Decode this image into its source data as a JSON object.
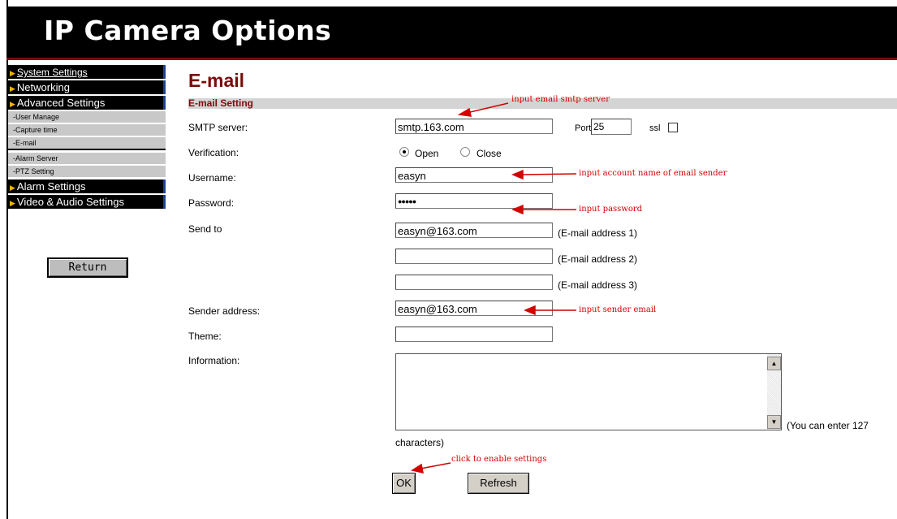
{
  "header": {
    "title": "IP Camera Options"
  },
  "sidebar": {
    "items": [
      {
        "label": "System Settings"
      },
      {
        "label": "Networking"
      },
      {
        "label": "Advanced Settings"
      }
    ],
    "subitems": [
      {
        "label": "-User Manage"
      },
      {
        "label": "-Capture time"
      },
      {
        "label": "-E-mail"
      },
      {
        "label": "-Alarm Server"
      },
      {
        "label": "-PTZ Setting"
      }
    ],
    "items2": [
      {
        "label": "Alarm Settings"
      },
      {
        "label": "Video & Audio Settings"
      }
    ],
    "return_label": "Return"
  },
  "page": {
    "title": "E-mail",
    "section": "E-mail Setting"
  },
  "form": {
    "smtp_label": "SMTP server:",
    "smtp_value": "smtp.163.com",
    "port_label": "Port",
    "port_value": "25",
    "ssl_label": "ssl",
    "verification_label": "Verification:",
    "open_label": "Open",
    "close_label": "Close",
    "username_label": "Username:",
    "username_value": "easyn",
    "password_label": "Password:",
    "password_value": "●●●●●",
    "sendto_label": "Send to",
    "email1_value": "easyn@163.com",
    "email1_hint": "(E-mail address 1)",
    "email2_value": "",
    "email2_hint": "(E-mail address 2)",
    "email3_value": "",
    "email3_hint": "(E-mail address 3)",
    "sender_label": "Sender address:",
    "sender_value": "easyn@163.com",
    "theme_label": "Theme:",
    "theme_value": "",
    "information_label": "Information:",
    "hint_part1": "(You can enter 127",
    "hint_part2": "characters)",
    "ok_label": "OK",
    "refresh_label": "Refresh"
  },
  "annotations": {
    "smtp": "input email smtp server",
    "username": "input account name of email sender",
    "password": "input password",
    "sender": "input sender email",
    "ok": "click to enable settings"
  },
  "colors": {
    "annotation": "#d40000",
    "title": "#7a0c0c",
    "header_bg": "#000000"
  }
}
